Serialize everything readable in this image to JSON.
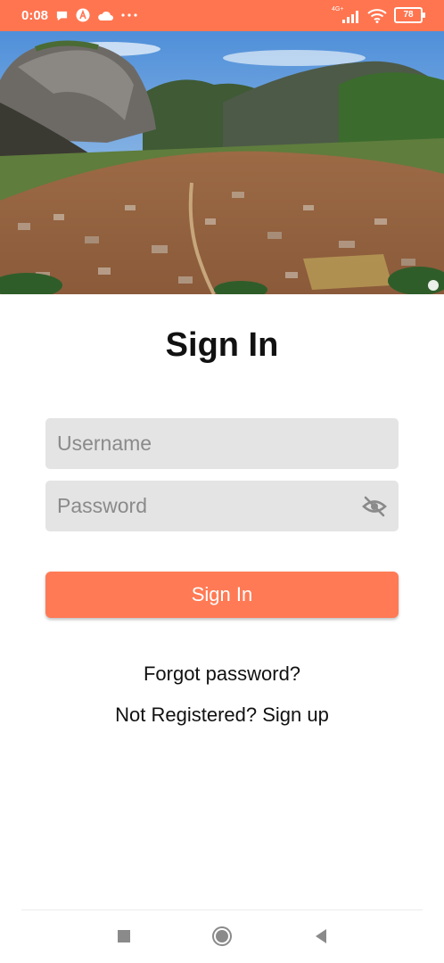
{
  "status_bar": {
    "time": "0:08",
    "network_label": "4G+",
    "battery_level": "78",
    "background_color": "#ff7550",
    "icons": [
      "chat-bubble-icon",
      "app-a-icon",
      "cloud-icon",
      "more-dots-icon",
      "signal-icon",
      "wifi-icon",
      "battery-icon"
    ]
  },
  "hero": {
    "image": "landscape photo of a town below large rock hills",
    "watermark_icon": "watermark-logo-icon"
  },
  "form": {
    "title": "Sign In",
    "username_placeholder": "Username",
    "password_placeholder": "Password",
    "password_visibility_icon": "eye-off-icon",
    "submit_label": "Sign In",
    "forgot_password_label": "Forgot password?",
    "register_label": "Not Registered? Sign up",
    "accent_color": "#ff7a55",
    "field_background": "#e4e4e4"
  },
  "nav_bar": {
    "icons": [
      "recents-square-icon",
      "home-circle-icon",
      "back-triangle-icon"
    ]
  }
}
